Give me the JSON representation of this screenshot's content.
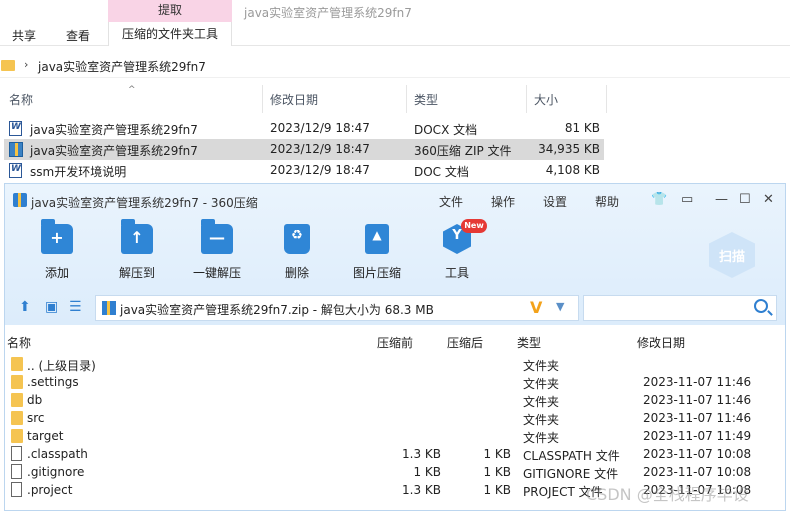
{
  "explorer": {
    "context_tab": "提取",
    "window_title": "java实验室资产管理系统29fn7",
    "tabs": [
      "共享",
      "查看",
      "压缩的文件夹工具"
    ],
    "address": "java实验室资产管理系统29fn7",
    "columns": [
      "名称",
      "修改日期",
      "类型",
      "大小"
    ],
    "files": [
      {
        "name": "java实验室资产管理系统29fn7",
        "date": "2023/12/9 18:47",
        "type": "DOCX 文档",
        "size": "81 KB",
        "icon": "word-doc-icon"
      },
      {
        "name": "java实验室资产管理系统29fn7",
        "date": "2023/12/9 18:47",
        "type": "360压缩 ZIP 文件",
        "size": "34,935 KB",
        "icon": "zip-archive-icon"
      },
      {
        "name": "ssm开发环境说明",
        "date": "2023/12/9 18:47",
        "type": "DOC 文档",
        "size": "4,108 KB",
        "icon": "word-doc-icon"
      }
    ]
  },
  "zip": {
    "title": "java实验室资产管理系统29fn7 - 360压缩",
    "menu": [
      "文件",
      "操作",
      "设置",
      "帮助"
    ],
    "toolbar": [
      "添加",
      "解压到",
      "一键解压",
      "删除",
      "图片压缩",
      "工具"
    ],
    "new_badge": "New",
    "scan_label": "扫描",
    "path": "java实验室资产管理系统29fn7.zip - 解包大小为 68.3 MB",
    "headers": [
      "名称",
      "压缩前",
      "压缩后",
      "类型",
      "修改日期"
    ],
    "rows": [
      {
        "name": ".. (上级目录)",
        "before": "",
        "after": "",
        "type": "文件夹",
        "date": "",
        "kind": "folder"
      },
      {
        "name": ".settings",
        "before": "",
        "after": "",
        "type": "文件夹",
        "date": "2023-11-07 11:46",
        "kind": "folder"
      },
      {
        "name": "db",
        "before": "",
        "after": "",
        "type": "文件夹",
        "date": "2023-11-07 11:46",
        "kind": "folder"
      },
      {
        "name": "src",
        "before": "",
        "after": "",
        "type": "文件夹",
        "date": "2023-11-07 11:46",
        "kind": "folder"
      },
      {
        "name": "target",
        "before": "",
        "after": "",
        "type": "文件夹",
        "date": "2023-11-07 11:49",
        "kind": "folder"
      },
      {
        "name": ".classpath",
        "before": "1.3 KB",
        "after": "1 KB",
        "type": "CLASSPATH 文件",
        "date": "2023-11-07 10:08",
        "kind": "file"
      },
      {
        "name": ".gitignore",
        "before": "1 KB",
        "after": "1 KB",
        "type": "GITIGNORE 文件",
        "date": "2023-11-07 10:08",
        "kind": "file"
      },
      {
        "name": ".project",
        "before": "1.3 KB",
        "after": "1 KB",
        "type": "PROJECT 文件",
        "date": "2023-11-07 10:08",
        "kind": "file"
      }
    ]
  },
  "watermark": "CSDN @全栈程序毕设"
}
